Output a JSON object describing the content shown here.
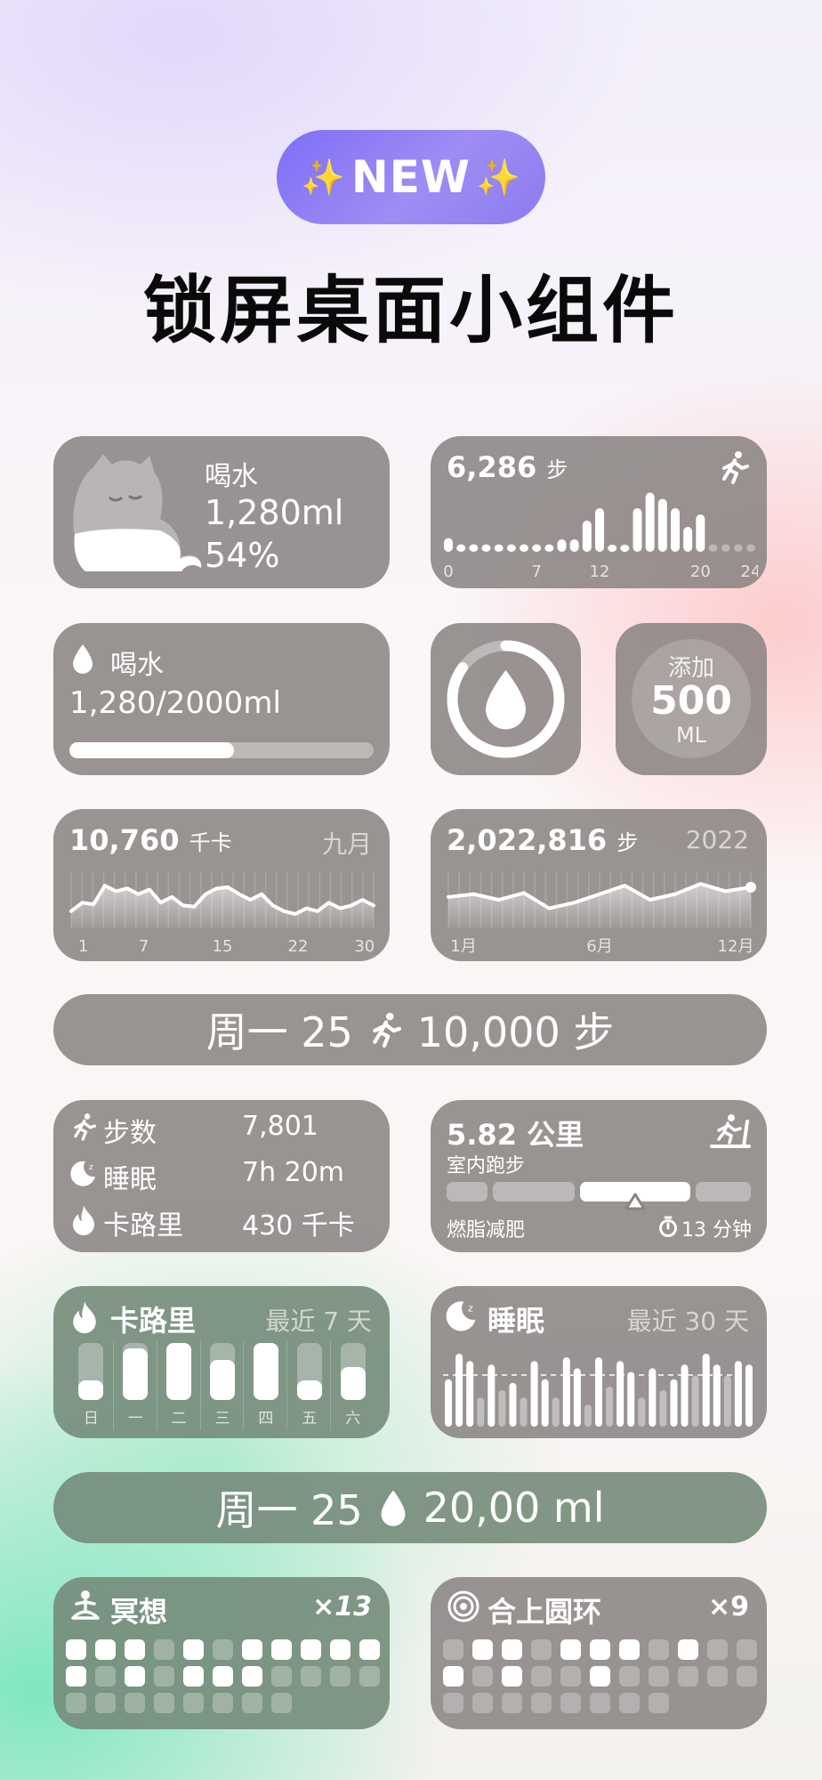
{
  "header": {
    "badge_spark_left": "✨",
    "badge_text": "NEW",
    "badge_spark_right": "✨",
    "title": "锁屏桌面小组件"
  },
  "water_cat": {
    "label": "喝水",
    "amount": "1,280ml",
    "percent": "54%"
  },
  "steps_hourly": {
    "count": "6,286",
    "unit": "步",
    "x_ticks": [
      "0",
      "7",
      "12",
      "20",
      "24"
    ],
    "values": [
      0.22,
      0.12,
      0.12,
      0.12,
      0.12,
      0.12,
      0.12,
      0.12,
      0.12,
      0.2,
      0.2,
      0.5,
      0.7,
      0.1,
      0.1,
      0.7,
      0.95,
      0.85,
      0.7,
      0.4,
      0.6,
      0.12,
      0.12,
      0.12,
      0.12
    ],
    "dim_from": 21
  },
  "water_progress": {
    "label": "喝水",
    "value": "1,280/2000ml",
    "progress": 0.54
  },
  "water_ring": {
    "progress": 0.85
  },
  "add_water": {
    "label": "添加",
    "amount": "500",
    "unit": "ML"
  },
  "calories_month": {
    "value": "10,760",
    "unit": "千卡",
    "period": "九月",
    "x_ticks": [
      "1",
      "7",
      "15",
      "22",
      "30"
    ],
    "values": [
      0.3,
      0.45,
      0.42,
      0.75,
      0.65,
      0.7,
      0.6,
      0.68,
      0.45,
      0.55,
      0.4,
      0.38,
      0.6,
      0.7,
      0.72,
      0.6,
      0.5,
      0.6,
      0.4,
      0.3,
      0.25,
      0.35,
      0.3,
      0.45,
      0.35,
      0.4,
      0.5,
      0.4
    ]
  },
  "steps_year": {
    "value": "2,022,816",
    "unit": "步",
    "period": "2022",
    "x_ticks": [
      "1月",
      "6月",
      "12月"
    ],
    "values": [
      0.55,
      0.6,
      0.5,
      0.62,
      0.35,
      0.45,
      0.6,
      0.75,
      0.5,
      0.6,
      0.78,
      0.65,
      0.72
    ]
  },
  "pill_steps": {
    "text_left": "周一 25",
    "text_right": "10,000 步"
  },
  "stats_list": {
    "rows": [
      {
        "label": "步数",
        "value": "7,801"
      },
      {
        "label": "睡眠",
        "value": "7h 20m"
      },
      {
        "label": "卡路里",
        "value": "430 千卡"
      }
    ]
  },
  "indoor_run": {
    "distance": "5.82 公里",
    "type": "室内跑步",
    "goal": "燃脂减肥",
    "duration": "13 分钟"
  },
  "calories_week": {
    "label": "卡路里",
    "period": "最近 7 天",
    "days": [
      "日",
      "一",
      "二",
      "三",
      "四",
      "五",
      "六"
    ],
    "values": [
      0.35,
      0.9,
      1.0,
      0.7,
      1.0,
      0.35,
      0.58
    ]
  },
  "sleep_month": {
    "label": "睡眠",
    "period": "最近 30 天",
    "values": [
      0.65,
      1.0,
      0.9,
      0.4,
      0.85,
      0.5,
      0.6,
      0.4,
      0.9,
      0.65,
      0.4,
      0.95,
      0.8,
      0.3,
      0.95,
      0.55,
      0.9,
      0.75,
      0.4,
      0.8,
      0.5,
      0.65,
      0.85,
      0.7,
      1.0,
      0.85,
      0.7,
      0.9,
      0.85
    ],
    "dim": [
      3,
      5,
      7,
      10,
      13,
      15,
      18,
      20,
      23,
      26
    ]
  },
  "pill_water": {
    "text_left": "周一 25",
    "text_right": "20,00 ml"
  },
  "meditation": {
    "label": "冥想",
    "count": "×13",
    "grid": [
      1,
      1,
      1,
      0,
      1,
      0,
      1,
      1,
      1,
      1,
      1,
      1,
      0,
      1,
      0,
      1,
      1,
      1,
      0,
      0,
      0,
      0,
      0,
      0,
      0,
      0,
      0,
      0
    ]
  },
  "rings": {
    "label": "合上圆环",
    "count": "×9",
    "grid": [
      0,
      1,
      1,
      0,
      1,
      1,
      1,
      0,
      1,
      0,
      0,
      1,
      0,
      1,
      0,
      0,
      1,
      0,
      0,
      0,
      0,
      0,
      0,
      0,
      0,
      0,
      0,
      0
    ]
  }
}
